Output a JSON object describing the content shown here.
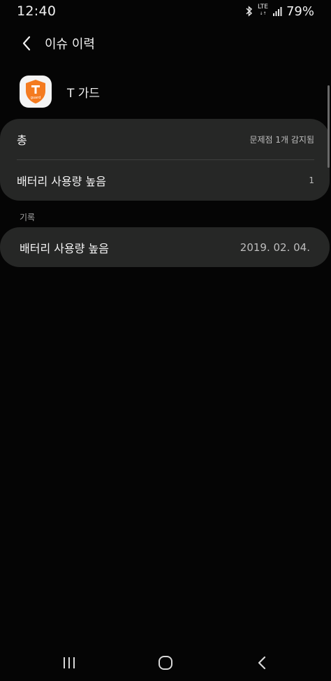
{
  "status_bar": {
    "time": "12:40",
    "network_top": "LTE",
    "network_bottom": "↓↑",
    "battery": "79%",
    "icons": [
      "bluetooth-icon",
      "signal-icon"
    ]
  },
  "header": {
    "title": "이슈 이력",
    "back_icon": "chevron-left-icon"
  },
  "app": {
    "name": "T 가드",
    "icon_text": "guard",
    "icon_color": "#f47b20"
  },
  "summary": {
    "total_label": "총",
    "total_value": "문제점 1개 감지됨",
    "issue_label": "배터리 사용량 높음",
    "issue_count": "1"
  },
  "history": {
    "section_label": "기록",
    "items": [
      {
        "title": "배터리 사용량 높음",
        "date": "2019. 02. 04."
      }
    ]
  },
  "nav_bar": {
    "icons": [
      "recent-apps-icon",
      "home-icon",
      "back-icon"
    ]
  },
  "colors": {
    "background": "#050505",
    "card": "#262726",
    "accent": "#f47b20"
  }
}
